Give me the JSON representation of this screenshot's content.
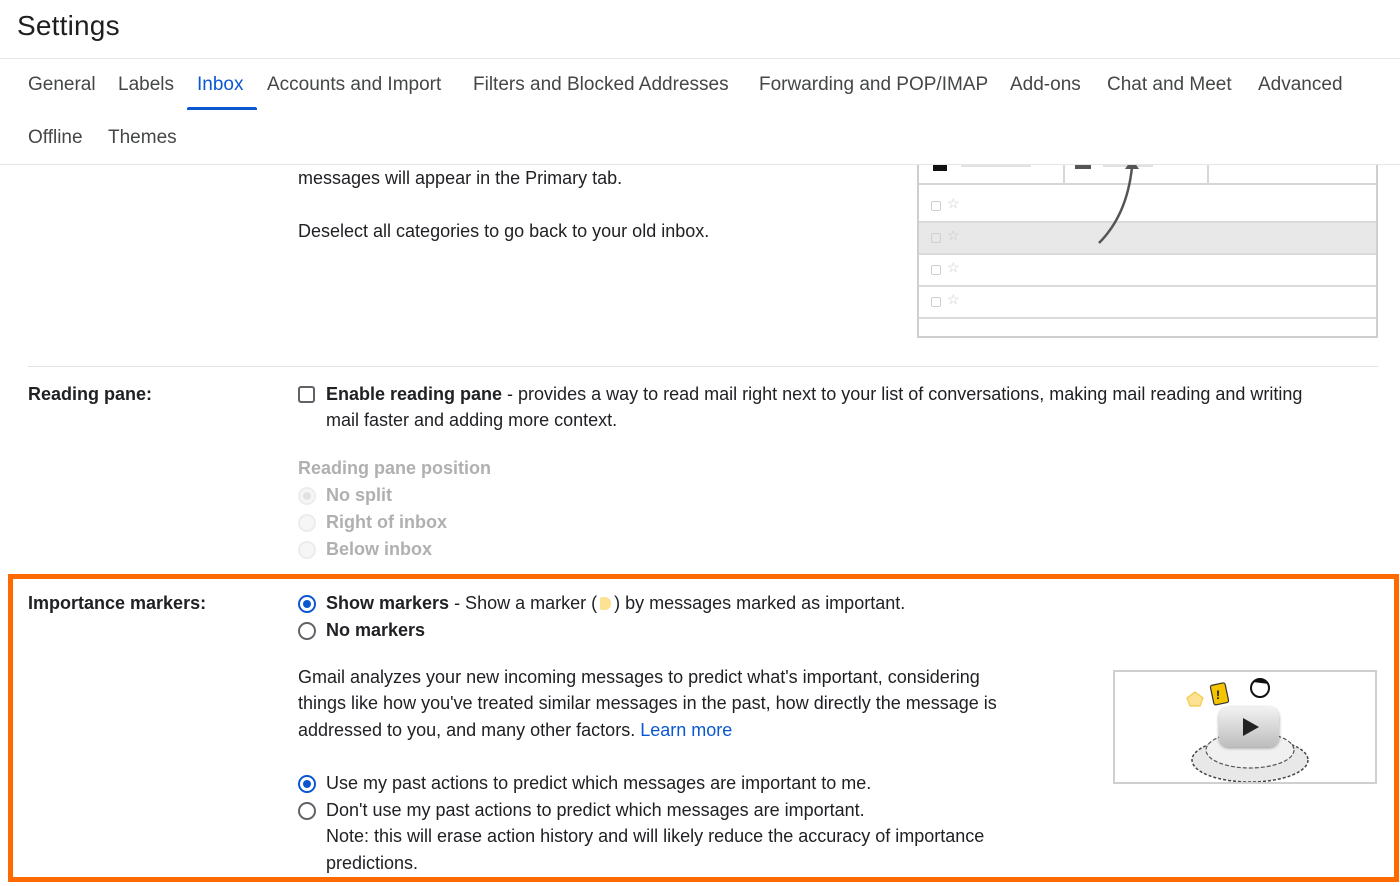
{
  "header": {
    "title": "Settings"
  },
  "tabs": [
    {
      "label": "General",
      "active": false
    },
    {
      "label": "Labels",
      "active": false
    },
    {
      "label": "Inbox",
      "active": true
    },
    {
      "label": "Accounts and Import",
      "active": false
    },
    {
      "label": "Filters and Blocked Addresses",
      "active": false
    },
    {
      "label": "Forwarding and POP/IMAP",
      "active": false
    },
    {
      "label": "Add-ons",
      "active": false
    },
    {
      "label": "Chat and Meet",
      "active": false
    },
    {
      "label": "Advanced",
      "active": false
    },
    {
      "label": "Offline",
      "active": false
    },
    {
      "label": "Themes",
      "active": false
    }
  ],
  "categories_section": {
    "text_line": "messages will appear in the Primary tab.",
    "deselect_text": "Deselect all categories to go back to your old inbox."
  },
  "reading_pane": {
    "label": "Reading pane:",
    "enable_label": "Enable reading pane",
    "enable_checked": false,
    "description_line1": " - provides a way to read mail right next to your list of conversations, making mail reading and writing",
    "description_line2": "mail faster and adding more context.",
    "position_heading": "Reading pane position",
    "position_options": [
      {
        "label": "No split",
        "selected": true,
        "disabled": true
      },
      {
        "label": "Right of inbox",
        "selected": false,
        "disabled": true
      },
      {
        "label": "Below inbox",
        "selected": false,
        "disabled": true
      }
    ]
  },
  "importance_markers": {
    "label": "Importance markers:",
    "show_label": "Show markers",
    "show_desc_before": " - Show a marker (",
    "show_desc_after": ") by messages marked as important.",
    "show_selected": true,
    "no_markers_label": "No markers",
    "no_markers_selected": false,
    "explain_line1": "Gmail analyzes your new incoming messages to predict what's important, considering",
    "explain_line2": "things like how you've treated similar messages in the past, how directly the message is",
    "explain_line3": "addressed to you, and many other factors.",
    "learn_more": "Learn more",
    "use_past_label": "Use my past actions to predict which messages are important to me.",
    "use_past_selected": true,
    "dont_use_label": "Don't use my past actions to predict which messages are important.",
    "dont_use_selected": false,
    "note_line1": "Note: this will erase action history and will likely reduce the accuracy of importance",
    "note_line2": "predictions.",
    "marker_color": "#fde293",
    "highlight_color": "#ff6a00"
  },
  "colors": {
    "accent": "#0b57d0",
    "text": "#202124",
    "muted": "#b0b0b0"
  }
}
